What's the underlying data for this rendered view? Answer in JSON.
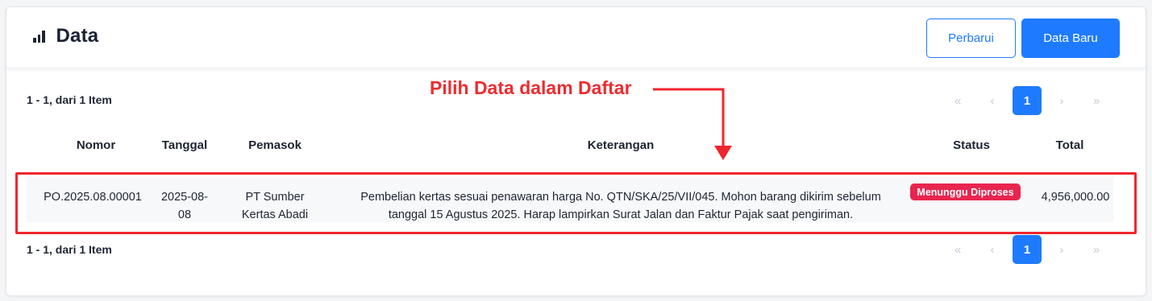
{
  "header": {
    "title": "Data",
    "icon": "bar-chart-icon",
    "refresh_label": "Perbarui",
    "new_label": "Data Baru"
  },
  "list": {
    "range_top": "1 - 1, dari 1 Item",
    "range_bottom": "1 - 1, dari 1 Item",
    "pagination": {
      "first": "«",
      "prev": "‹",
      "current": "1",
      "next": "›",
      "last": "»"
    },
    "columns": [
      "Nomor",
      "Tanggal",
      "Pemasok",
      "Keterangan",
      "Status",
      "Total"
    ],
    "rows": [
      {
        "nomor": "PO.2025.08.00001",
        "tanggal_1": "2025-08-",
        "tanggal_2": "08",
        "pemasok_1": "PT Sumber",
        "pemasok_2": "Kertas Abadi",
        "keterangan_1": "Pembelian kertas sesuai penawaran harga No. QTN/SKA/25/VII/045. Mohon barang dikirim sebelum",
        "keterangan_2": "tanggal 15 Agustus 2025. Harap lampirkan Surat Jalan dan Faktur Pajak saat pengiriman.",
        "status": "Menunggu Diproses",
        "total": "4,956,000.00"
      }
    ]
  },
  "annotation": {
    "text": "Pilih Data dalam Daftar",
    "color": "#ee2b2e"
  },
  "colors": {
    "primary": "#1e7bff",
    "badge": "#e8254f",
    "annotation": "#f0262e"
  }
}
